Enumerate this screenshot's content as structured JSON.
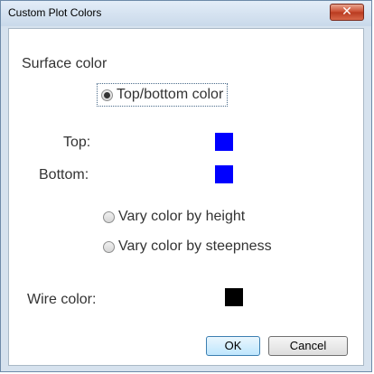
{
  "window": {
    "title": "Custom Plot Colors",
    "close_glyph": "✕"
  },
  "surface": {
    "section_label": "Surface color",
    "option_top_bottom": "Top/bottom color",
    "top_label": "Top:",
    "bottom_label": "Bottom:",
    "top_color": "#0000ff",
    "bottom_color": "#0000ff",
    "option_height": "Vary color by height",
    "option_steepness": "Vary color by steepness",
    "selected_option": "Top/bottom color"
  },
  "wire": {
    "label": "Wire color:",
    "color": "#000000"
  },
  "buttons": {
    "ok": "OK",
    "cancel": "Cancel"
  }
}
